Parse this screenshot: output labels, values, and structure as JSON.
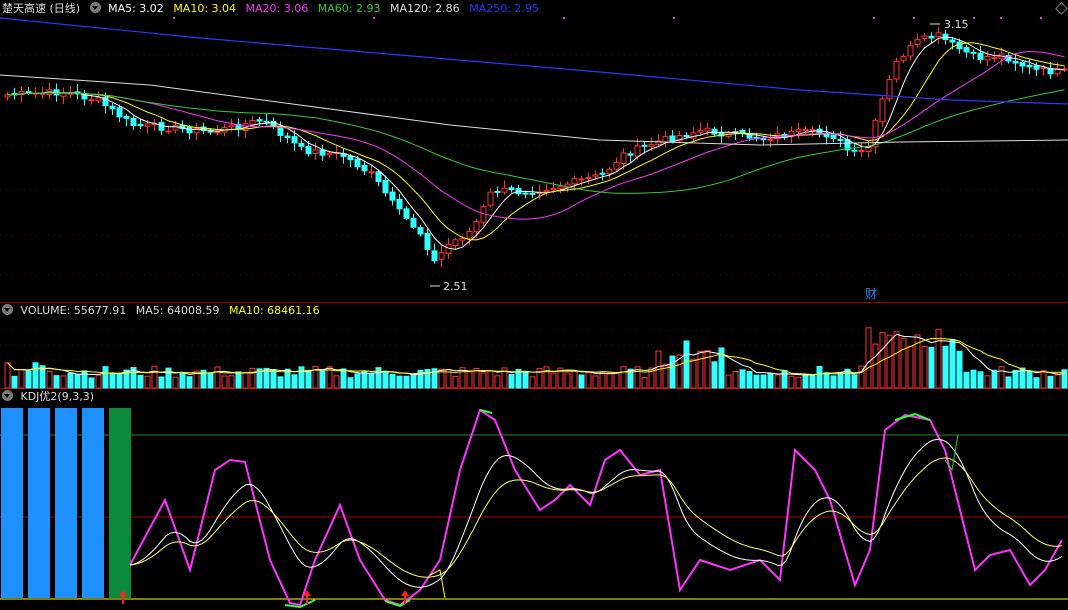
{
  "main_panel": {
    "title": "楚天高速 (日线)",
    "ma_labels": [
      {
        "text": "MA5: 3.02",
        "color": "#ffffff"
      },
      {
        "text": "MA10: 3.04",
        "color": "#ffff00"
      },
      {
        "text": "MA20: 3.06",
        "color": "#ff33ff"
      },
      {
        "text": "MA60: 2.93",
        "color": "#33cc33"
      },
      {
        "text": "MA120: 2.86",
        "color": "#dddddd"
      },
      {
        "text": "MA250: 2.95",
        "color": "#3333ff"
      }
    ],
    "high_marker": "3.15",
    "low_marker": "2.51",
    "event_marker": "财"
  },
  "volume_panel": {
    "labels": [
      {
        "text": "VOLUME: 55677.91",
        "color": "#dddddd"
      },
      {
        "text": "MA5: 64008.59",
        "color": "#dddddd"
      },
      {
        "text": "MA10: 68461.16",
        "color": "#ffff00"
      }
    ]
  },
  "kdj_panel": {
    "label": "KDJ优2(9,3,3)"
  },
  "colors": {
    "up": "#ff3333",
    "down": "#33ffff",
    "ma250": "#3333ff",
    "ma120": "#dddddd",
    "ma60": "#33cc33",
    "ma20": "#ff33ff",
    "ma10": "#ffff00",
    "ma5": "#ffffff",
    "j_line": "#ff33ff",
    "j_low": "#33ff33",
    "grid": "#8b0000",
    "bar_blue": "#1e90ff",
    "bar_green": "#0a8a3a"
  }
}
